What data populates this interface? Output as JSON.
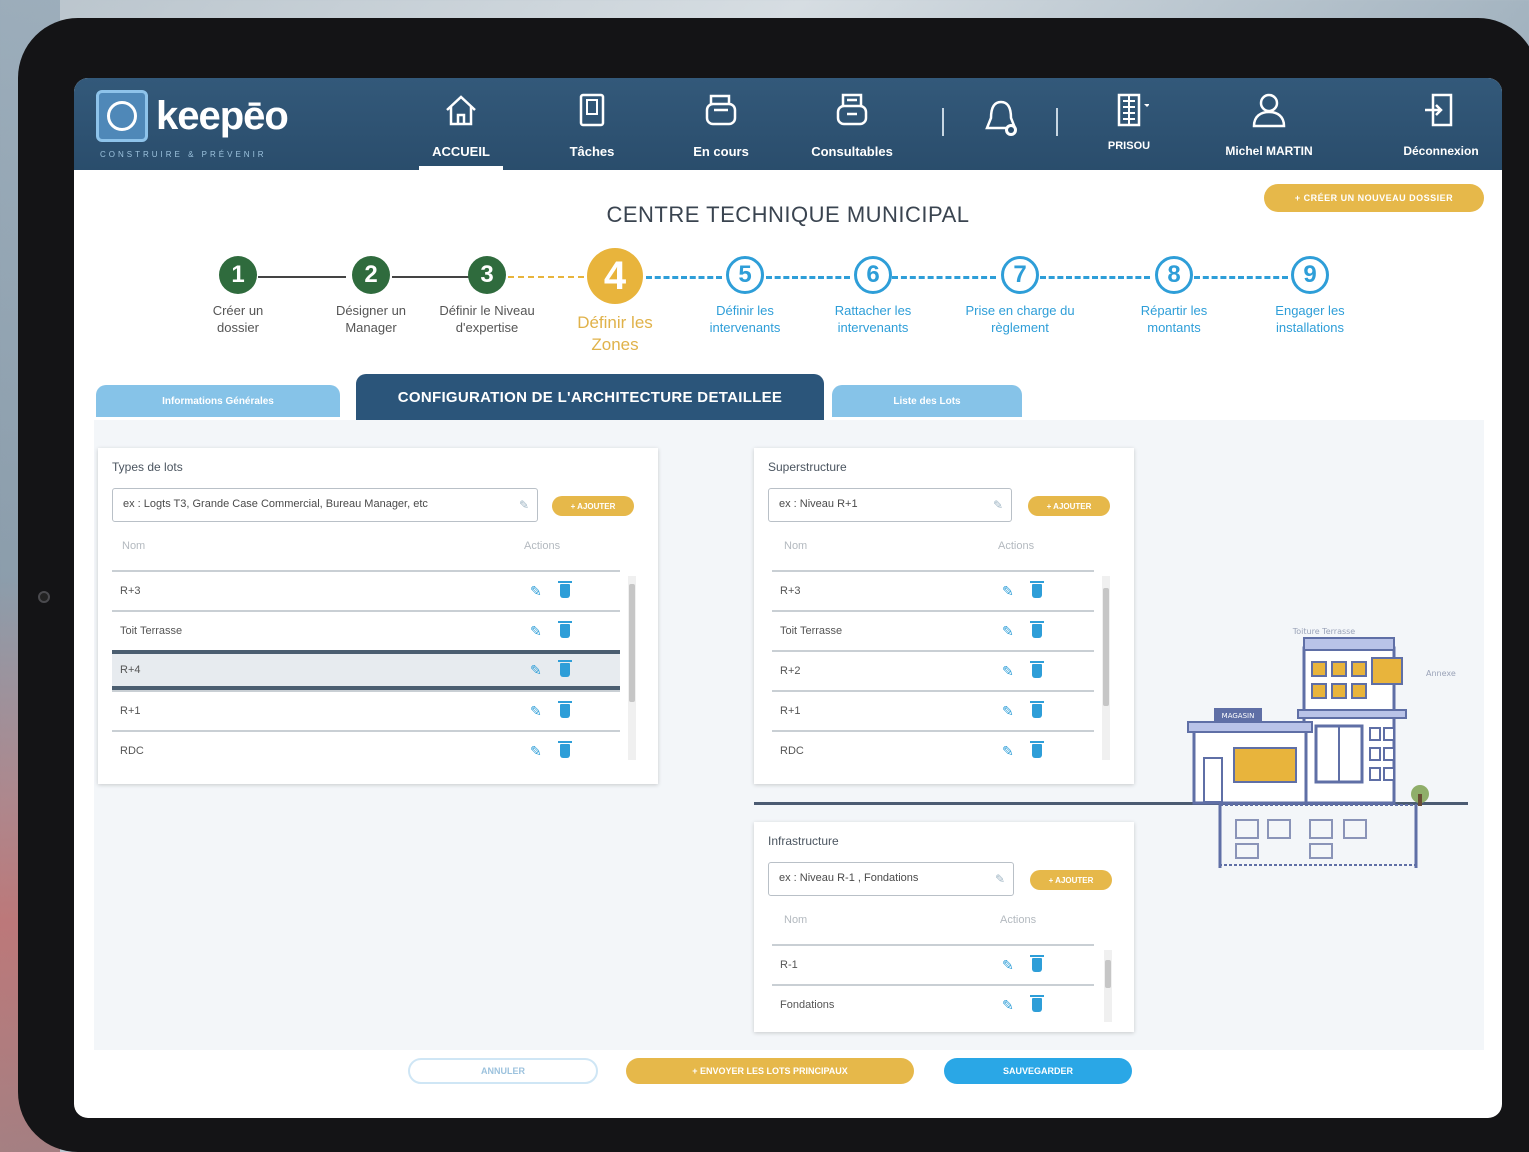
{
  "app": {
    "logo_text": "keepēo",
    "logo_tagline": "CONSTRUIRE & PRÉVENIR"
  },
  "nav": {
    "items": [
      {
        "label": "ACCUEIL",
        "icon": "home-icon",
        "active": true
      },
      {
        "label": "Tâches",
        "icon": "document-icon"
      },
      {
        "label": "En cours",
        "icon": "folder-stack-icon"
      },
      {
        "label": "Consultables",
        "icon": "archive-icon"
      }
    ],
    "notifications_icon": "bell-icon",
    "org": {
      "label": "PRISOU",
      "icon": "building-icon"
    },
    "user": {
      "label": "Michel MARTIN",
      "icon": "user-icon"
    },
    "logout": {
      "label": "Déconnexion",
      "icon": "exit-door-icon"
    }
  },
  "page": {
    "title": "CENTRE TECHNIQUE MUNICIPAL",
    "new_folder_button": "+ CRÉER UN NOUVEAU DOSSIER"
  },
  "stepper": {
    "steps": [
      {
        "number": "1",
        "label": "Créer un dossier",
        "state": "done"
      },
      {
        "number": "2",
        "label": "Désigner un Manager",
        "state": "done"
      },
      {
        "number": "3",
        "label": "Définir le Niveau d'expertise",
        "state": "done"
      },
      {
        "number": "4",
        "label": "Définir les Zones",
        "state": "current"
      },
      {
        "number": "5",
        "label": "Définir les intervenants",
        "state": "todo"
      },
      {
        "number": "6",
        "label": "Rattacher les intervenants",
        "state": "todo"
      },
      {
        "number": "7",
        "label": "Prise en charge du règlement",
        "state": "todo"
      },
      {
        "number": "8",
        "label": "Répartir les montants",
        "state": "todo"
      },
      {
        "number": "9",
        "label": "Engager les installations",
        "state": "todo"
      }
    ]
  },
  "tabs": [
    {
      "label": "Informations Générales"
    },
    {
      "label": "CONFIGURATION DE L'ARCHITECTURE DETAILLEE"
    },
    {
      "label": "Liste des Lots"
    }
  ],
  "panels": {
    "types_lots": {
      "title": "Types de lots",
      "input_value": "ex : Logts T3, Grande Case Commercial, Bureau Manager, etc",
      "add_label": "+ AJOUTER",
      "col_name": "Nom",
      "col_actions": "Actions",
      "rows": [
        "R+3",
        "Toit Terrasse",
        "R+4",
        "R+1",
        "RDC"
      ]
    },
    "superstructure": {
      "title": "Superstructure",
      "input_value": "ex : Niveau R+1",
      "add_label": "+ AJOUTER",
      "col_name": "Nom",
      "col_actions": "Actions",
      "rows": [
        "R+3",
        "Toit Terrasse",
        "R+2",
        "R+1",
        "RDC"
      ]
    },
    "infrastructure": {
      "title": "Infrastructure",
      "input_value": "ex : Niveau R-1 , Fondations",
      "add_label": "+ AJOUTER",
      "col_name": "Nom",
      "col_actions": "Actions",
      "rows": [
        "R-1",
        "Fondations"
      ]
    }
  },
  "illustration": {
    "shop_sign": "MAGASIN",
    "roof_label": "Toiture Terrasse",
    "annex_label": "Annexe"
  },
  "footer": {
    "cancel": "ANNULER",
    "save_lots": "+ ENVOYER LES LOTS PRINCIPAUX",
    "validate": "SAUVEGARDER"
  },
  "colors": {
    "header": "#2a4d6c",
    "gold": "#e6b84a",
    "accent_blue": "#2e9ed8",
    "done_green": "#2f6b3d"
  }
}
